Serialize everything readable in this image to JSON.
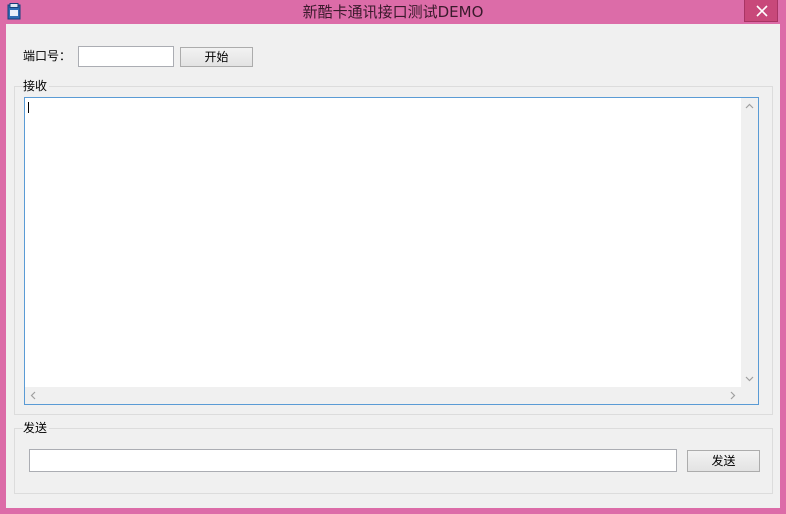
{
  "window": {
    "title": "新酷卡通讯接口测试DEMO"
  },
  "port": {
    "label": "端口号：",
    "value": "",
    "start_button": "开始"
  },
  "receive": {
    "group_title": "接收",
    "content": ""
  },
  "send": {
    "group_title": "发送",
    "value": "",
    "send_button": "发送"
  },
  "icons": {
    "app": "app-icon",
    "close": "close-icon",
    "scroll_up": "chevron-up-icon",
    "scroll_down": "chevron-down-icon",
    "scroll_left": "chevron-left-icon",
    "scroll_right": "chevron-right-icon"
  },
  "colors": {
    "titlebar": "#dc6ca8",
    "close_button": "#c8487a",
    "client_background": "#f0f0f0",
    "focus_border": "#5a9bd5"
  }
}
